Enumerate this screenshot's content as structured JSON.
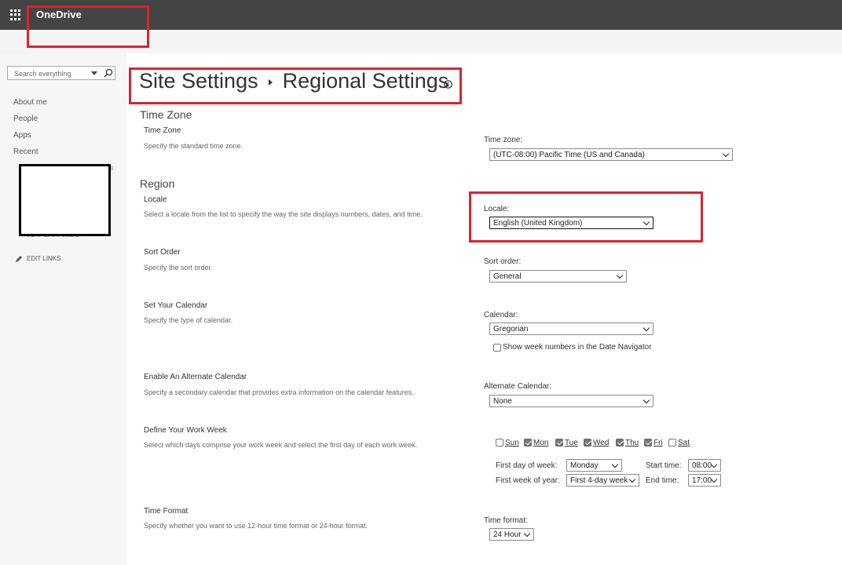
{
  "suite": {
    "app_name": "OneDrive",
    "icon": "app-launcher-icon"
  },
  "sidebar": {
    "search_placeholder": "Search everything",
    "items": [
      {
        "label": "About me"
      },
      {
        "label": "People"
      },
      {
        "label": "Apps"
      },
      {
        "label": "Recent"
      }
    ],
    "recent_fragments": [
      "s",
      "i",
      "-",
      "6C4FCAFF53DE"
    ],
    "edit_links": "EDIT LINKS"
  },
  "breadcrumb": {
    "parent": "Site Settings",
    "current": "Regional Settings"
  },
  "sections": {
    "time_zone": {
      "heading": "Time Zone",
      "title": "Time Zone",
      "desc": "Specify the standard time zone.",
      "label": "Time zone:",
      "value": "(UTC-08:00) Pacific Time (US and Canada)"
    },
    "region": {
      "heading": "Region",
      "locale": {
        "title": "Locale",
        "desc": "Select a locale from the list to specify the way the site displays numbers, dates, and time.",
        "label": "Locale:",
        "value": "English (United Kingdom)"
      },
      "sort": {
        "title": "Sort Order",
        "desc": "Specify the sort order.",
        "label": "Sort order:",
        "value": "General"
      },
      "calendar": {
        "title": "Set Your Calendar",
        "desc": "Specify the type of calendar.",
        "label": "Calendar:",
        "value": "Gregorian",
        "week_numbers_label": "Show week numbers in the Date Navigator",
        "week_numbers_checked": false
      },
      "alt_calendar": {
        "title": "Enable An Alternate Calendar",
        "desc": "Specify a secondary calendar that provides extra information on the calendar features.",
        "label": "Alternate Calendar:",
        "value": "None"
      },
      "work_week": {
        "title": "Define Your Work Week",
        "desc": "Select which days comprise your work week and select the first day of each work week.",
        "days": [
          {
            "label": "Sun",
            "checked": false
          },
          {
            "label": "Mon",
            "checked": true
          },
          {
            "label": "Tue",
            "checked": true
          },
          {
            "label": "Wed",
            "checked": true
          },
          {
            "label": "Thu",
            "checked": true
          },
          {
            "label": "Fri",
            "checked": true
          },
          {
            "label": "Sat",
            "checked": false
          }
        ],
        "first_day_label": "First day of week:",
        "first_day_value": "Monday",
        "first_week_label": "First week of year:",
        "first_week_value": "First 4-day week",
        "start_time_label": "Start time:",
        "start_time_value": "08:00",
        "end_time_label": "End time:",
        "end_time_value": "17:00"
      },
      "time_format": {
        "title": "Time Format",
        "desc": "Specify whether you want to use 12-hour time format or 24-hour format.",
        "label": "Time format:",
        "value": "24 Hour"
      }
    }
  },
  "colors": {
    "suitebar": "#444444",
    "highlight": "#e0212f"
  }
}
